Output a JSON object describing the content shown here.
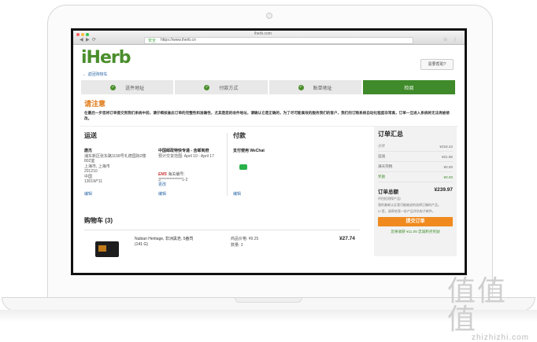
{
  "browser": {
    "tab_title": "iherb.com",
    "url_secure": "安全",
    "url": "https://www.iherb.cn"
  },
  "header": {
    "logo": "iHerb",
    "back_link": "← 返回购物车",
    "help_button": "需要帮助?"
  },
  "steps": [
    {
      "label": "送件地址",
      "done": true
    },
    {
      "label": "付款方式",
      "done": true
    },
    {
      "label": "账单地址",
      "done": true
    },
    {
      "label": "检阅",
      "done": false
    }
  ],
  "notice": {
    "title": "请注意",
    "text": "在最后一步您将订单提交到我们系统中前，请仔细核查此订单的完整性和准确性，尤其是您的收件地址，请确认它是正确的，为了尽可能高效的服务我们的客户，我们的订购系统自动化程度非常高，订单一旦进入系统将无法再被修改。"
  },
  "shipping": {
    "title": "运送",
    "name": "唐杰",
    "address_lines": [
      "浦东新区张东路1158号礼德国际2楼",
      "802室",
      "上海市, 上海市",
      "201210",
      "中国",
      "1301W*11"
    ],
    "edit": "编辑",
    "method_title": "中国邮政特快专递 - 含邮到府",
    "method_desc": "预计交货范围: April 10 - April 17",
    "customs_label": "海关编号:",
    "customs_value": "3**************1-2",
    "change": "更改",
    "method_edit": "编辑"
  },
  "payment": {
    "title": "付款",
    "method": "支付使用 WeChat",
    "edit": "编辑"
  },
  "summary": {
    "title": "订单汇总",
    "rows": [
      {
        "label": "小计",
        "value": "¥218.42"
      },
      {
        "label": "运送",
        "value": "¥21.55"
      },
      {
        "label": "满天完税",
        "value": "¥0.00"
      },
      {
        "label": "奖励",
        "value": "¥0.00"
      }
    ],
    "total_label": "订单总额",
    "total_value": "¥239.97",
    "note1": "评估检测保产品!",
    "note2": "我的美邮认证我可能被退的选择正确的产品。",
    "note3": "是，请寄给我一份产品评估电子邮件。",
    "submit": "提交订单",
    "reward": "您将收获 ¥11.05 忠诚积点奖励"
  },
  "cart": {
    "title": "购物车 (3)",
    "item_name": "Nubian Heritage, 非洲黑皂, 5盎司 (141 G)",
    "item_price_label": "商品价格: ¥9.25",
    "item_qty_label": "数量: 3",
    "item_total": "¥27.74"
  },
  "watermark": {
    "big": "值值值",
    "small": "zhizhizhi.com"
  }
}
